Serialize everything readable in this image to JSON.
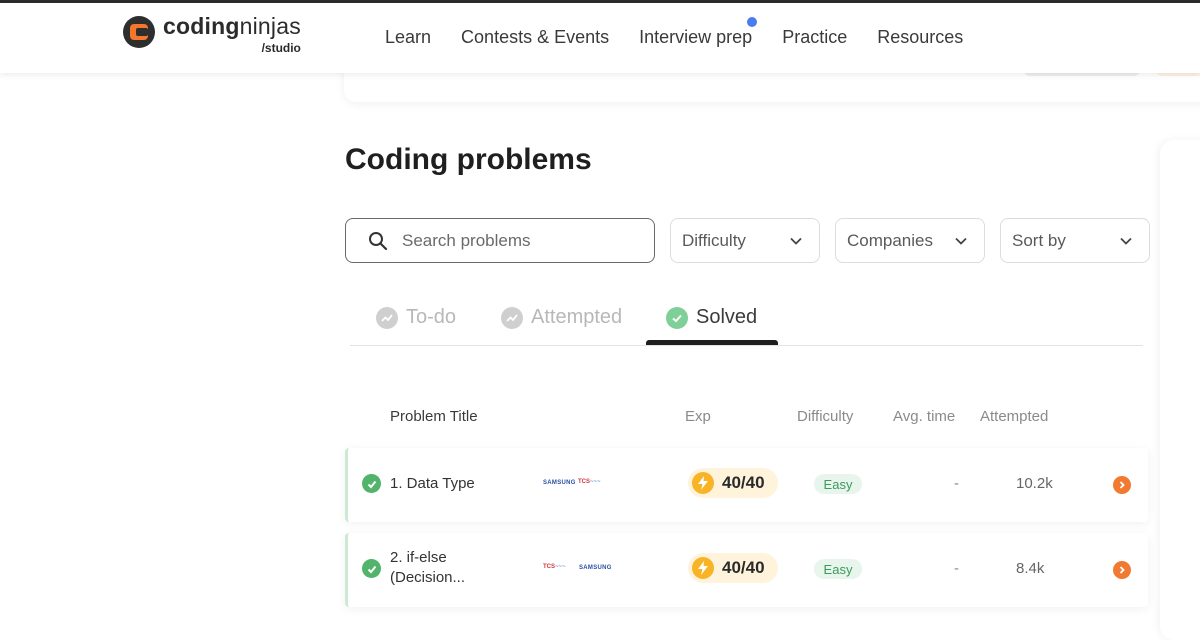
{
  "brand": {
    "name_bold": "coding",
    "name_light": "ninjas",
    "sub": "/studio"
  },
  "nav": {
    "items": [
      "Learn",
      "Contests & Events",
      "Interview prep",
      "Practice",
      "Resources"
    ]
  },
  "page": {
    "title": "Coding problems"
  },
  "search": {
    "placeholder": "Search problems",
    "value": ""
  },
  "filters": {
    "difficulty": "Difficulty",
    "companies": "Companies",
    "sort": "Sort by"
  },
  "tabs": [
    {
      "label": "To-do",
      "active": false
    },
    {
      "label": "Attempted",
      "active": false
    },
    {
      "label": "Solved",
      "active": true
    }
  ],
  "table": {
    "headers": {
      "title": "Problem Title",
      "exp": "Exp",
      "difficulty": "Difficulty",
      "avg_time": "Avg. time",
      "attempted": "Attempted"
    },
    "rows": [
      {
        "title_line1": "1. Data Type",
        "title_line2": "",
        "companies": [
          "SAMSUNG",
          "TCS"
        ],
        "exp": "40/40",
        "difficulty": "Easy",
        "avg_time": "-",
        "attempted": "10.2k",
        "solved": true
      },
      {
        "title_line1": "2. if-else",
        "title_line2": "(Decision...",
        "companies": [
          "TCS",
          "SAMSUNG"
        ],
        "exp": "40/40",
        "difficulty": "Easy",
        "avg_time": "-",
        "attempted": "8.4k",
        "solved": true
      }
    ]
  },
  "colors": {
    "accent": "#f07a31",
    "solved_green": "#52b36b",
    "nav_dot": "#4a7bf0",
    "exp_bg": "#fff3dc",
    "bolt": "#f8b425"
  },
  "icons": {
    "search": "search-icon",
    "chevron": "chevron-down-icon",
    "check": "check-circle-icon",
    "trend": "trend-icon",
    "bolt": "lightning-icon",
    "arrow": "chevron-right-icon"
  }
}
